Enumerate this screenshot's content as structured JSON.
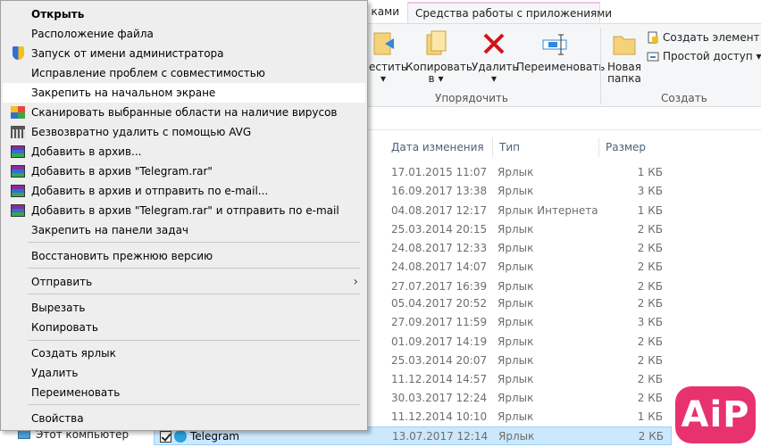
{
  "ribbon": {
    "tabs": [
      {
        "label": "ками"
      },
      {
        "label": "Средства работы с приложениями"
      }
    ],
    "buttons": {
      "move": "местить",
      "copy_line1": "Копировать",
      "copy_line2": "в",
      "delete": "Удалить",
      "rename": "Переименовать",
      "new_folder_line1": "Новая",
      "new_folder_line2": "папка",
      "new_item": "Создать элемент",
      "easy_access": "Простой доступ"
    },
    "groups": {
      "organize": "Упорядочить",
      "create": "Создать"
    },
    "colors": {
      "delete_x": "#d0141b",
      "tab_accent": "#f0c3e8"
    }
  },
  "file_list": {
    "columns": [
      "Дата изменения",
      "Тип",
      "Размер"
    ],
    "rows": [
      {
        "date": "17.01.2015 11:07",
        "type": "Ярлык",
        "size": "1 КБ"
      },
      {
        "date": "16.09.2017 13:38",
        "type": "Ярлык",
        "size": "3 КБ"
      },
      {
        "date": "04.08.2017 12:17",
        "type": "Ярлык Интернета",
        "size": "1 КБ"
      },
      {
        "date": "25.03.2014 20:15",
        "type": "Ярлык",
        "size": "2 КБ"
      },
      {
        "date": "24.08.2017 12:33",
        "type": "Ярлык",
        "size": "2 КБ"
      },
      {
        "date": "24.08.2017 14:07",
        "type": "Ярлык",
        "size": "2 КБ"
      },
      {
        "date": "27.07.2017 16:39",
        "type": "Ярлык",
        "size": "2 КБ"
      },
      {
        "date": "05.04.2017 20:52",
        "type": "Ярлык",
        "size": "2 КБ"
      },
      {
        "date": "27.09.2017 11:59",
        "type": "Ярлык",
        "size": "3 КБ"
      },
      {
        "date": "01.09.2017 14:19",
        "type": "Ярлык",
        "size": "2 КБ"
      },
      {
        "date": "25.03.2014 20:07",
        "type": "Ярлык",
        "size": "2 КБ"
      },
      {
        "date": "11.12.2014 14:57",
        "type": "Ярлык",
        "size": "2 КБ"
      },
      {
        "date": "30.03.2017 12:24",
        "type": "Ярлык",
        "size": "2 КБ"
      },
      {
        "date": "11.12.2014 10:10",
        "type": "Ярлык",
        "size": "1 КБ"
      }
    ],
    "selected_row": {
      "name": "Telegram",
      "date": "13.07.2017 12:14",
      "type": "Ярлык",
      "size": "2 КБ"
    }
  },
  "nav": {
    "this_pc": "Этот компьютер"
  },
  "context_menu": {
    "items": [
      {
        "label": "Открыть",
        "icon": "none",
        "bold": true
      },
      {
        "label": "Расположение файла",
        "icon": "none"
      },
      {
        "label": "Запуск от имени администратора",
        "icon": "shield-icon"
      },
      {
        "label": "Исправление проблем с совместимостью",
        "icon": "none"
      },
      {
        "label": "Закрепить на начальном экране",
        "icon": "none",
        "highlighted": true
      },
      {
        "label": "Сканировать выбранные области на наличие вирусов",
        "icon": "avg-icon"
      },
      {
        "label": "Безвозвратно удалить с помощью AVG",
        "icon": "shredder-icon"
      },
      {
        "label": "Добавить в архив...",
        "icon": "winrar-icon"
      },
      {
        "label": "Добавить в архив \"Telegram.rar\"",
        "icon": "winrar-icon"
      },
      {
        "label": "Добавить в архив и отправить по e-mail...",
        "icon": "winrar-icon"
      },
      {
        "label": "Добавить в архив \"Telegram.rar\" и отправить по e-mail",
        "icon": "winrar-icon"
      },
      {
        "label": "Закрепить на панели задач",
        "icon": "none"
      },
      {
        "label": "Восстановить прежнюю версию",
        "icon": "none"
      },
      {
        "label": "Отправить",
        "icon": "none",
        "submenu": true
      },
      {
        "label": "Вырезать",
        "icon": "none"
      },
      {
        "label": "Копировать",
        "icon": "none"
      },
      {
        "label": "Создать ярлык",
        "icon": "none"
      },
      {
        "label": "Удалить",
        "icon": "none"
      },
      {
        "label": "Переименовать",
        "icon": "none"
      },
      {
        "label": "Свойства",
        "icon": "none"
      }
    ]
  },
  "watermark": {
    "text": "AiP",
    "color": "#e8326e"
  }
}
